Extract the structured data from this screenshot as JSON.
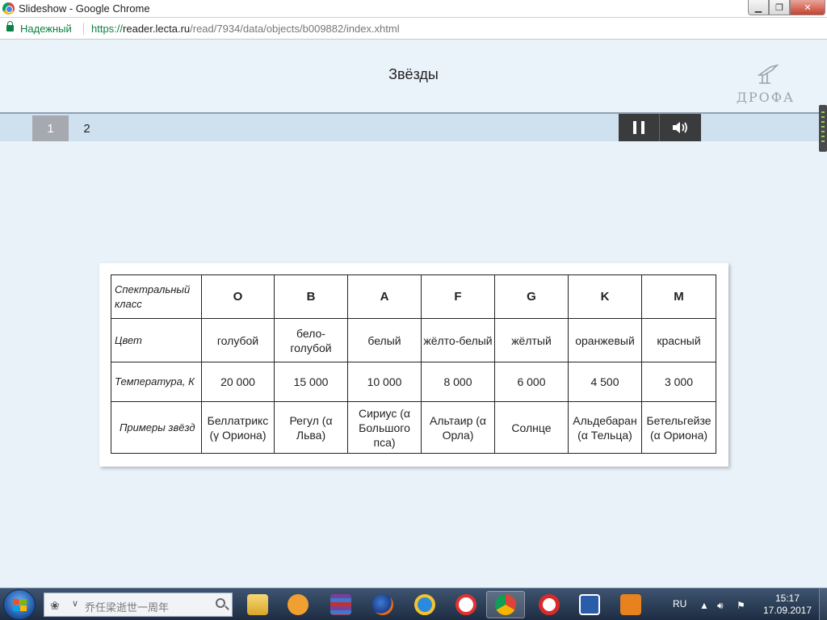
{
  "window": {
    "title": "Slideshow - Google Chrome",
    "controls": {
      "minimize": "▁",
      "maximize": "❐",
      "close": "✕"
    }
  },
  "address": {
    "secure_label": "Надежный",
    "url_scheme": "https://",
    "url_host": "reader.lecta.ru",
    "url_path": "/read/7934/data/objects/b009882/index.xhtml"
  },
  "slide": {
    "title": "Звёзды",
    "logo_text": "ДРОФА"
  },
  "pager": {
    "pages": [
      "1",
      "2"
    ],
    "current": "1"
  },
  "table": {
    "header_label": "Спектральный класс",
    "classes": [
      "O",
      "B",
      "A",
      "F",
      "G",
      "K",
      "M"
    ],
    "rows": [
      {
        "label": "Цвет",
        "values": [
          "голубой",
          "бело-голубой",
          "белый",
          "жёлто-белый",
          "жёлтый",
          "оранжевый",
          "красный"
        ]
      },
      {
        "label": "Температура, К",
        "values": [
          "20 000",
          "15 000",
          "10 000",
          "8 000",
          "6 000",
          "4 500",
          "3 000"
        ]
      },
      {
        "label": "Примеры звёзд",
        "values": [
          "Беллатрикс (γ Ориона)",
          "Регул (α Льва)",
          "Сириус (α Большого пса)",
          "Альтаир (α Орла)",
          "Солнце",
          "Альдебаран (α Тельца)",
          "Бетельгейзе (α Ориона)"
        ]
      }
    ]
  },
  "taskbar": {
    "search_text": "乔任梁逝世一周年",
    "language": "RU",
    "time": "15:17",
    "date": "17.09.2017",
    "apps": [
      "file-explorer",
      "media-player",
      "winrar",
      "firefox",
      "internet-explorer",
      "yandex-browser",
      "chrome",
      "opera",
      "word",
      "pdf-reader"
    ]
  },
  "colors": {
    "page_bg": "#e9f1f9",
    "pager_bg": "#cfe0ee",
    "active_page": "#a6aab0",
    "control_bg": "#3a3b3c",
    "secure_green": "#0b8043"
  }
}
